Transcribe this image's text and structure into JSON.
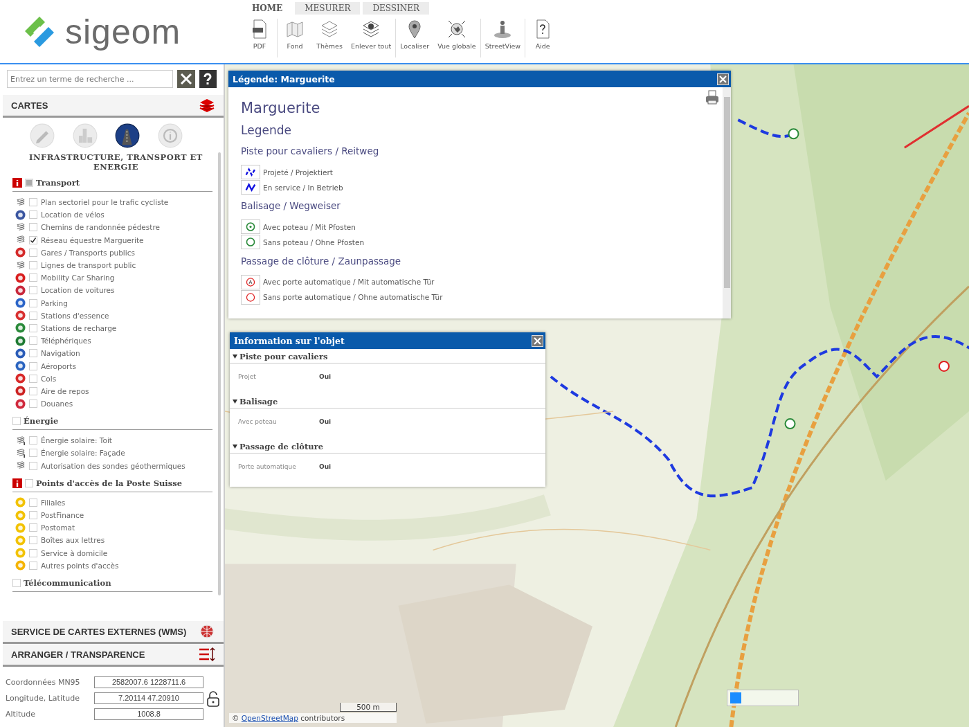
{
  "logo": {
    "text": "sigeom"
  },
  "tabs": [
    {
      "label": "HOME",
      "selected": true
    },
    {
      "label": "MESURER",
      "selected": false
    },
    {
      "label": "DESSINER",
      "selected": false
    }
  ],
  "toolbar": [
    {
      "label": "PDF",
      "kind": "pdf",
      "separator_after": true
    },
    {
      "label": "Fond",
      "kind": "map",
      "separator_after": false
    },
    {
      "label": "Thèmes",
      "kind": "layers",
      "separator_after": false
    },
    {
      "label": "Enlever tout",
      "kind": "remove-layers",
      "separator_after": true
    },
    {
      "label": "Localiser",
      "kind": "pin",
      "separator_after": false
    },
    {
      "label": "Vue globale",
      "kind": "globe",
      "separator_after": true
    },
    {
      "label": "StreetView",
      "kind": "person",
      "separator_after": true
    },
    {
      "label": "Aide",
      "kind": "help",
      "separator_after": false
    }
  ],
  "search": {
    "placeholder": "Entrez un terme de recherche ..."
  },
  "cartes": {
    "title": "CARTES"
  },
  "themes": [
    {
      "kind": "edit",
      "selected": false
    },
    {
      "kind": "city",
      "selected": false
    },
    {
      "kind": "road",
      "selected": true
    },
    {
      "kind": "info",
      "selected": false
    }
  ],
  "theme_title": "INFRASTRUCTURE, TRANSPORT ET ENERGIE",
  "groups": [
    {
      "name": "Transport",
      "info": true,
      "checked": false,
      "partial": true,
      "items": [
        {
          "label": "Plan sectoriel pour le trafic cycliste",
          "kind": "layers",
          "checked": false
        },
        {
          "label": "Location de vélos",
          "kind": "badge",
          "color": "#3a55a0",
          "checked": false
        },
        {
          "label": "Chemins de randonnée pédestre",
          "kind": "layers",
          "checked": false
        },
        {
          "label": "Réseau équestre Marguerite",
          "kind": "layers",
          "checked": true
        },
        {
          "label": "Gares / Transports publics",
          "kind": "badge",
          "color": "#d42a2a",
          "checked": false
        },
        {
          "label": "Lignes de transport public",
          "kind": "layers",
          "checked": false
        },
        {
          "label": "Mobility Car Sharing",
          "kind": "badge",
          "color": "#d81e1e",
          "checked": false
        },
        {
          "label": "Location de voitures",
          "kind": "badge",
          "color": "#c8283c",
          "checked": false
        },
        {
          "label": "Parking",
          "kind": "badge",
          "color": "#2a64c8",
          "checked": false
        },
        {
          "label": "Stations d'essence",
          "kind": "badge",
          "color": "#d83030",
          "checked": false
        },
        {
          "label": "Stations de recharge",
          "kind": "badge",
          "color": "#2a8a3a",
          "checked": false
        },
        {
          "label": "Téléphériques",
          "kind": "badge",
          "color": "#1e7a32",
          "checked": false
        },
        {
          "label": "Navigation",
          "kind": "badge",
          "color": "#2a5cb8",
          "checked": false
        },
        {
          "label": "Aéroports",
          "kind": "badge",
          "color": "#2a64c0",
          "checked": false
        },
        {
          "label": "Cols",
          "kind": "badge",
          "color": "#d82a2a",
          "checked": false
        },
        {
          "label": "Aire de repos",
          "kind": "badge",
          "color": "#cc2222",
          "checked": false
        },
        {
          "label": "Douanes",
          "kind": "badge",
          "color": "#d0283c",
          "checked": false
        }
      ]
    },
    {
      "name": "Énergie",
      "info": false,
      "checked": false,
      "partial": false,
      "items": [
        {
          "label": "Énergie solaire: Toit",
          "kind": "layers-info",
          "checked": false
        },
        {
          "label": "Énergie solaire: Façade",
          "kind": "layers-info",
          "checked": false
        },
        {
          "label": "Autorisation des sondes géothermiques",
          "kind": "layers",
          "checked": false
        }
      ]
    },
    {
      "name": "Points d'accès de la Poste Suisse",
      "info": true,
      "checked": false,
      "partial": false,
      "items": [
        {
          "label": "Filiales",
          "kind": "badge",
          "color": "#f2c200",
          "checked": false
        },
        {
          "label": "PostFinance",
          "kind": "badge",
          "color": "#f2c200",
          "checked": false
        },
        {
          "label": "Postomat",
          "kind": "badge",
          "color": "#f2c200",
          "checked": false
        },
        {
          "label": "Boîtes aux lettres",
          "kind": "badge",
          "color": "#f2c200",
          "checked": false
        },
        {
          "label": "Service à domicile",
          "kind": "badge",
          "color": "#f2c200",
          "checked": false
        },
        {
          "label": "Autres points d'accès",
          "kind": "badge",
          "color": "#f5b400",
          "checked": false
        }
      ]
    },
    {
      "name": "Télécommunication",
      "info": false,
      "checked": false,
      "partial": false
    }
  ],
  "panels": [
    {
      "title": "SERVICE DE CARTES EXTERNES (WMS)",
      "kind": "globe"
    },
    {
      "title": "ARRANGER / TRANSPARENCE",
      "kind": "sort"
    }
  ],
  "coordinates": [
    {
      "label": "Coordonnées MN95",
      "value": "2582007.6 1228711.6"
    },
    {
      "label": "Longitude, Latitude",
      "value": "7.20114 47.20910"
    },
    {
      "label": "Altitude",
      "value": "1008.8"
    }
  ],
  "legend_window": {
    "title": "Légende: Marguerite",
    "heading": "Marguerite",
    "subheading": "Legende",
    "sections": [
      {
        "title": "Piste pour cavaliers / Reitweg",
        "entries": [
          {
            "kind": "dashed-line",
            "label": "Projeté / Projektiert"
          },
          {
            "kind": "line",
            "label": "En service / In Betrieb"
          }
        ]
      },
      {
        "title": "Balisage / Wegweiser",
        "entries": [
          {
            "kind": "post-circle",
            "label": "Avec poteau / Mit Pfosten"
          },
          {
            "kind": "circle",
            "label": "Sans poteau / Ohne Pfosten"
          }
        ]
      },
      {
        "title": "Passage de clôture / Zaunpassage",
        "entries": [
          {
            "kind": "letter-circle",
            "letter": "A",
            "label": "Avec porte automatique / Mit automatische Tür"
          },
          {
            "kind": "red-circle",
            "label": "Sans porte automatique / Ohne automatische Tür"
          }
        ]
      }
    ]
  },
  "info_window": {
    "title": "Information sur l'objet",
    "sections": [
      {
        "title": "Piste pour cavaliers",
        "expanded": true,
        "rows": [
          {
            "label": "Projet",
            "value": "Oui"
          }
        ]
      },
      {
        "title": "Balisage",
        "expanded": true,
        "rows": [
          {
            "label": "Avec poteau",
            "value": "Oui"
          }
        ]
      },
      {
        "title": "Passage de clôture",
        "expanded": true,
        "rows": [
          {
            "label": "Porte automatique",
            "value": "Oui"
          }
        ]
      }
    ]
  },
  "scale": "500 m",
  "attribution": {
    "prefix": "©",
    "link": "OpenStreetMap",
    "suffix": "contributors"
  }
}
